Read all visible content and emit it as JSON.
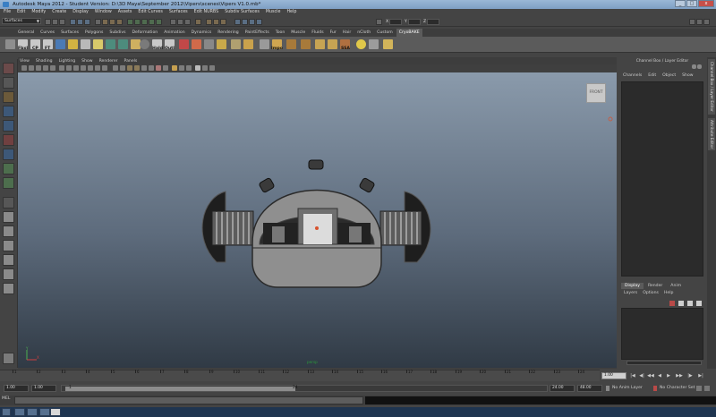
{
  "window": {
    "title": "Autodesk Maya 2012 - Student Version: D:\\3D Maya\\September 2012\\Vipers\\scenes\\Vipers V1.0.mb*",
    "minimize": "_",
    "maximize": "□",
    "close": "x"
  },
  "menubar": [
    "File",
    "Edit",
    "Modify",
    "Create",
    "Display",
    "Window",
    "Assets",
    "Edit Curves",
    "Surfaces",
    "Edit NURBS",
    "Subdiv Surfaces",
    "Muscle",
    "Help"
  ],
  "status": {
    "mode": "Surfaces",
    "fields": [
      "X",
      "Y",
      "Z"
    ]
  },
  "shelf": {
    "tabs": [
      "General",
      "Curves",
      "Surfaces",
      "Polygons",
      "Subdivs",
      "Deformation",
      "Animation",
      "Dynamics",
      "Rendering",
      "PaintEffects",
      "Toon",
      "Muscle",
      "Fluids",
      "Fur",
      "Hair",
      "nCloth",
      "Custom",
      "CryoBAKE"
    ],
    "selected": "CryoBAKE",
    "labels": {
      "fbxl": "FbxI",
      "cp": "CP",
      "ft": "FT",
      "hald": "HaId",
      "outl": "Outl",
      "impo": "Impo",
      "ssa": "SSA"
    }
  },
  "panel": {
    "menu": [
      "View",
      "Shading",
      "Lighting",
      "Show",
      "Renderer",
      "Panels"
    ],
    "viewcube": "FRONT",
    "camera": "persp",
    "axis_x": "X",
    "axis_y": "Y"
  },
  "channelbox": {
    "title": "Channel Box / Layer Editor",
    "menu": [
      "Channels",
      "Edit",
      "Object",
      "Show"
    ],
    "side_tabs": [
      "Channel Box / Layer Editor",
      "Attribute Editor"
    ]
  },
  "layers": {
    "tabs": [
      "Display",
      "Render",
      "Anim"
    ],
    "selected": "Display",
    "menu": [
      "Layers",
      "Options",
      "Help"
    ]
  },
  "timeline": {
    "ticks": [
      1,
      2,
      3,
      4,
      5,
      6,
      7,
      8,
      9,
      10,
      11,
      12,
      13,
      14,
      15,
      16,
      17,
      18,
      19,
      20,
      21,
      22,
      23,
      24
    ],
    "current_frame": "1.00",
    "playback": [
      "|◀",
      "◀|",
      "◀◀",
      "◀",
      "▶",
      "▶▶",
      "|▶",
      "▶|"
    ]
  },
  "range": {
    "start": "1.00",
    "playback_start": "1.00",
    "slider_start": "1",
    "slider_end": "24",
    "playback_end": "24.00",
    "end": "48.00",
    "anim_layer": "No Anim Layer",
    "character_set": "No Character Set",
    "fill": 0.48
  },
  "commandline": {
    "label": "MEL"
  },
  "colors": {
    "titlebar": "#8aa9cc",
    "viewport_top": "#8a9aab",
    "viewport_bottom": "#303a45",
    "model": "#8f8f8f",
    "selected_tab": "#5b5b5b"
  }
}
